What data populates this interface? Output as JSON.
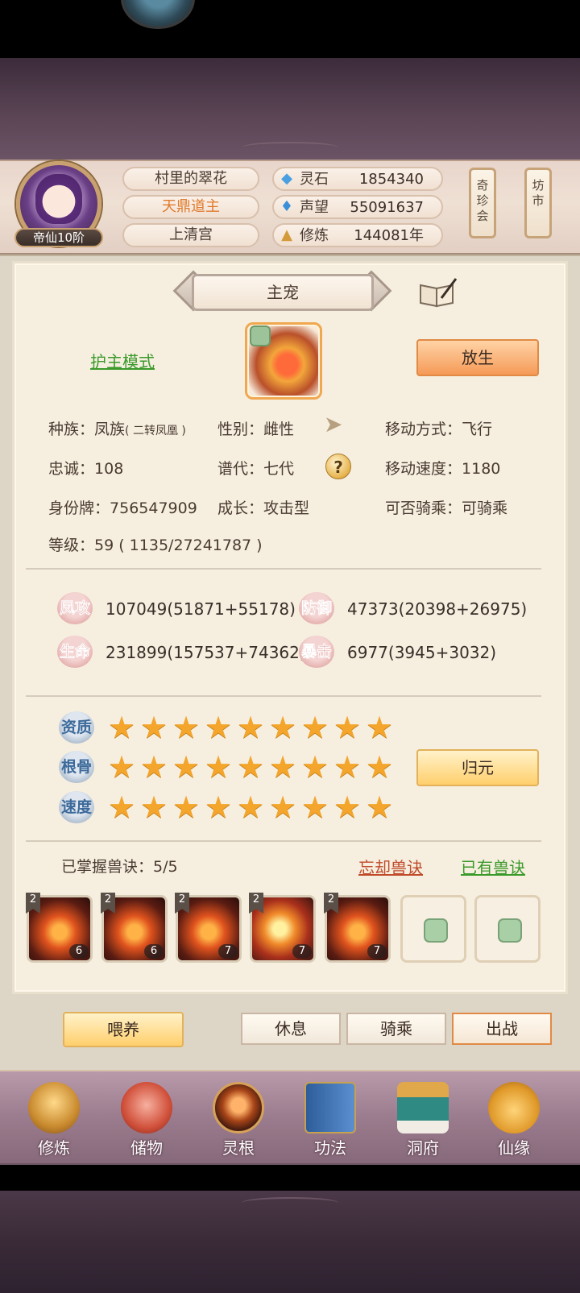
{
  "header": {
    "rank": "帝仙10阶",
    "name": "村里的翠花",
    "title": "天鼎道主",
    "sect": "上清宫",
    "resources": [
      {
        "icon": "spirit-stone-icon",
        "label": "灵石",
        "value": "1854340"
      },
      {
        "icon": "reputation-icon",
        "label": "声望",
        "value": "55091637"
      },
      {
        "icon": "cultivation-icon",
        "label": "修炼",
        "value": "144081年"
      }
    ],
    "side_buttons": [
      "奇珍会",
      "坊市"
    ]
  },
  "panel": {
    "banner": "主宠",
    "guard_mode": "护主模式",
    "release": "放生",
    "info": {
      "race_label": "种族：",
      "race": "凤族",
      "race_sub": "( 二转凤凰 )",
      "gender_label": "性别：",
      "gender": "雌性",
      "move_label": "移动方式：",
      "move": "飞行",
      "loyalty_label": "忠诚：",
      "loyalty": "108",
      "gen_label": "谱代：",
      "gen": "七代",
      "speed_label": "移动速度：",
      "speed": "1180",
      "id_label": "身份牌：",
      "id": "756547909",
      "growth_label": "成长：",
      "growth": "攻击型",
      "ride_label": "可否骑乘：",
      "ride": "可骑乘",
      "level_label": "等级：",
      "level": "59 ( 1135/27241787 )"
    },
    "stats": [
      {
        "label": "凤攻",
        "value": "107049(51871+55178)"
      },
      {
        "label": "防御",
        "value": "47373(20398+26975)"
      },
      {
        "label": "生命",
        "value": "231899(157537+74362)"
      },
      {
        "label": "暴击",
        "value": "6977(3945+3032)"
      }
    ],
    "aptitudes": [
      {
        "label": "资质",
        "stars": 9
      },
      {
        "label": "根骨",
        "stars": 9
      },
      {
        "label": "速度",
        "stars": 9
      }
    ],
    "guiyuan": "归元",
    "skills_mastered": "已掌握兽诀：5/5",
    "forget": "忘却兽诀",
    "owned": "已有兽诀",
    "skills": [
      {
        "tier": "2",
        "level": "6"
      },
      {
        "tier": "2",
        "level": "6"
      },
      {
        "tier": "2",
        "level": "7"
      },
      {
        "tier": "2",
        "level": "7"
      },
      {
        "tier": "2",
        "level": "7"
      }
    ]
  },
  "actions": {
    "feed": "喂养",
    "rest": "休息",
    "ride": "骑乘",
    "battle": "出战"
  },
  "nav": [
    {
      "icon": "cultivate-icon",
      "label": "修炼"
    },
    {
      "icon": "storage-bag-icon",
      "label": "储物"
    },
    {
      "icon": "spirit-root-icon",
      "label": "灵根"
    },
    {
      "icon": "technique-book-icon",
      "label": "功法"
    },
    {
      "icon": "cave-mansion-icon",
      "label": "洞府"
    },
    {
      "icon": "fate-gourd-icon",
      "label": "仙缘"
    }
  ]
}
